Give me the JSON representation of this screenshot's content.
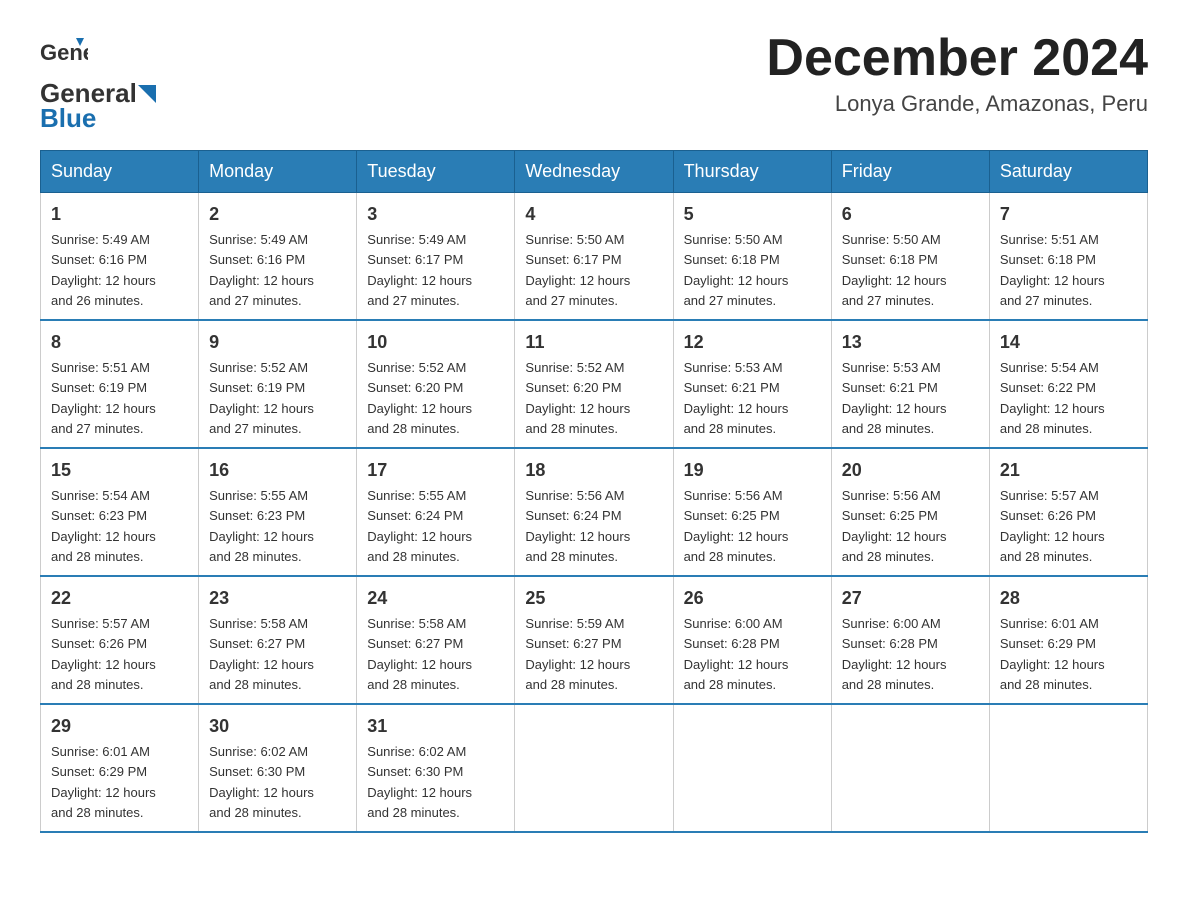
{
  "logo": {
    "general": "General",
    "blue": "Blue"
  },
  "header": {
    "month": "December 2024",
    "location": "Lonya Grande, Amazonas, Peru"
  },
  "weekdays": [
    "Sunday",
    "Monday",
    "Tuesday",
    "Wednesday",
    "Thursday",
    "Friday",
    "Saturday"
  ],
  "weeks": [
    [
      {
        "day": 1,
        "sunrise": "5:49 AM",
        "sunset": "6:16 PM",
        "daylight": "12 hours and 26 minutes."
      },
      {
        "day": 2,
        "sunrise": "5:49 AM",
        "sunset": "6:16 PM",
        "daylight": "12 hours and 27 minutes."
      },
      {
        "day": 3,
        "sunrise": "5:49 AM",
        "sunset": "6:17 PM",
        "daylight": "12 hours and 27 minutes."
      },
      {
        "day": 4,
        "sunrise": "5:50 AM",
        "sunset": "6:17 PM",
        "daylight": "12 hours and 27 minutes."
      },
      {
        "day": 5,
        "sunrise": "5:50 AM",
        "sunset": "6:18 PM",
        "daylight": "12 hours and 27 minutes."
      },
      {
        "day": 6,
        "sunrise": "5:50 AM",
        "sunset": "6:18 PM",
        "daylight": "12 hours and 27 minutes."
      },
      {
        "day": 7,
        "sunrise": "5:51 AM",
        "sunset": "6:18 PM",
        "daylight": "12 hours and 27 minutes."
      }
    ],
    [
      {
        "day": 8,
        "sunrise": "5:51 AM",
        "sunset": "6:19 PM",
        "daylight": "12 hours and 27 minutes."
      },
      {
        "day": 9,
        "sunrise": "5:52 AM",
        "sunset": "6:19 PM",
        "daylight": "12 hours and 27 minutes."
      },
      {
        "day": 10,
        "sunrise": "5:52 AM",
        "sunset": "6:20 PM",
        "daylight": "12 hours and 28 minutes."
      },
      {
        "day": 11,
        "sunrise": "5:52 AM",
        "sunset": "6:20 PM",
        "daylight": "12 hours and 28 minutes."
      },
      {
        "day": 12,
        "sunrise": "5:53 AM",
        "sunset": "6:21 PM",
        "daylight": "12 hours and 28 minutes."
      },
      {
        "day": 13,
        "sunrise": "5:53 AM",
        "sunset": "6:21 PM",
        "daylight": "12 hours and 28 minutes."
      },
      {
        "day": 14,
        "sunrise": "5:54 AM",
        "sunset": "6:22 PM",
        "daylight": "12 hours and 28 minutes."
      }
    ],
    [
      {
        "day": 15,
        "sunrise": "5:54 AM",
        "sunset": "6:23 PM",
        "daylight": "12 hours and 28 minutes."
      },
      {
        "day": 16,
        "sunrise": "5:55 AM",
        "sunset": "6:23 PM",
        "daylight": "12 hours and 28 minutes."
      },
      {
        "day": 17,
        "sunrise": "5:55 AM",
        "sunset": "6:24 PM",
        "daylight": "12 hours and 28 minutes."
      },
      {
        "day": 18,
        "sunrise": "5:56 AM",
        "sunset": "6:24 PM",
        "daylight": "12 hours and 28 minutes."
      },
      {
        "day": 19,
        "sunrise": "5:56 AM",
        "sunset": "6:25 PM",
        "daylight": "12 hours and 28 minutes."
      },
      {
        "day": 20,
        "sunrise": "5:56 AM",
        "sunset": "6:25 PM",
        "daylight": "12 hours and 28 minutes."
      },
      {
        "day": 21,
        "sunrise": "5:57 AM",
        "sunset": "6:26 PM",
        "daylight": "12 hours and 28 minutes."
      }
    ],
    [
      {
        "day": 22,
        "sunrise": "5:57 AM",
        "sunset": "6:26 PM",
        "daylight": "12 hours and 28 minutes."
      },
      {
        "day": 23,
        "sunrise": "5:58 AM",
        "sunset": "6:27 PM",
        "daylight": "12 hours and 28 minutes."
      },
      {
        "day": 24,
        "sunrise": "5:58 AM",
        "sunset": "6:27 PM",
        "daylight": "12 hours and 28 minutes."
      },
      {
        "day": 25,
        "sunrise": "5:59 AM",
        "sunset": "6:27 PM",
        "daylight": "12 hours and 28 minutes."
      },
      {
        "day": 26,
        "sunrise": "6:00 AM",
        "sunset": "6:28 PM",
        "daylight": "12 hours and 28 minutes."
      },
      {
        "day": 27,
        "sunrise": "6:00 AM",
        "sunset": "6:28 PM",
        "daylight": "12 hours and 28 minutes."
      },
      {
        "day": 28,
        "sunrise": "6:01 AM",
        "sunset": "6:29 PM",
        "daylight": "12 hours and 28 minutes."
      }
    ],
    [
      {
        "day": 29,
        "sunrise": "6:01 AM",
        "sunset": "6:29 PM",
        "daylight": "12 hours and 28 minutes."
      },
      {
        "day": 30,
        "sunrise": "6:02 AM",
        "sunset": "6:30 PM",
        "daylight": "12 hours and 28 minutes."
      },
      {
        "day": 31,
        "sunrise": "6:02 AM",
        "sunset": "6:30 PM",
        "daylight": "12 hours and 28 minutes."
      },
      null,
      null,
      null,
      null
    ]
  ],
  "labels": {
    "sunrise": "Sunrise:",
    "sunset": "Sunset:",
    "daylight": "Daylight:"
  }
}
